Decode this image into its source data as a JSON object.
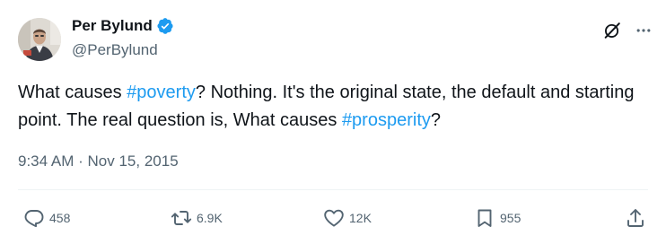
{
  "author": {
    "name": "Per Bylund",
    "handle": "@PerBylund"
  },
  "tweet": {
    "segments": [
      {
        "text": "What causes ",
        "type": "text"
      },
      {
        "text": "#poverty",
        "type": "hashtag"
      },
      {
        "text": "? Nothing. It's the original state, the default and starting point. The real question is, What causes ",
        "type": "text"
      },
      {
        "text": "#prosperity",
        "type": "hashtag"
      },
      {
        "text": "?",
        "type": "text"
      }
    ],
    "time": "9:34 AM",
    "separator": "·",
    "date": "Nov 15, 2015"
  },
  "actions": {
    "replies": "458",
    "reposts": "6.9K",
    "likes": "12K",
    "bookmarks": "955"
  },
  "icons": {
    "verified": "verified-badge-icon",
    "grok": "grok-icon",
    "more": "more-dots-icon",
    "reply": "reply-bubble-icon",
    "repost": "repost-arrows-icon",
    "like": "heart-icon",
    "bookmark": "bookmark-icon",
    "share": "share-upload-icon"
  },
  "colors": {
    "accent": "#1d9bf0",
    "text": "#0f1419",
    "muted": "#536471",
    "divider": "#eff3f4"
  }
}
